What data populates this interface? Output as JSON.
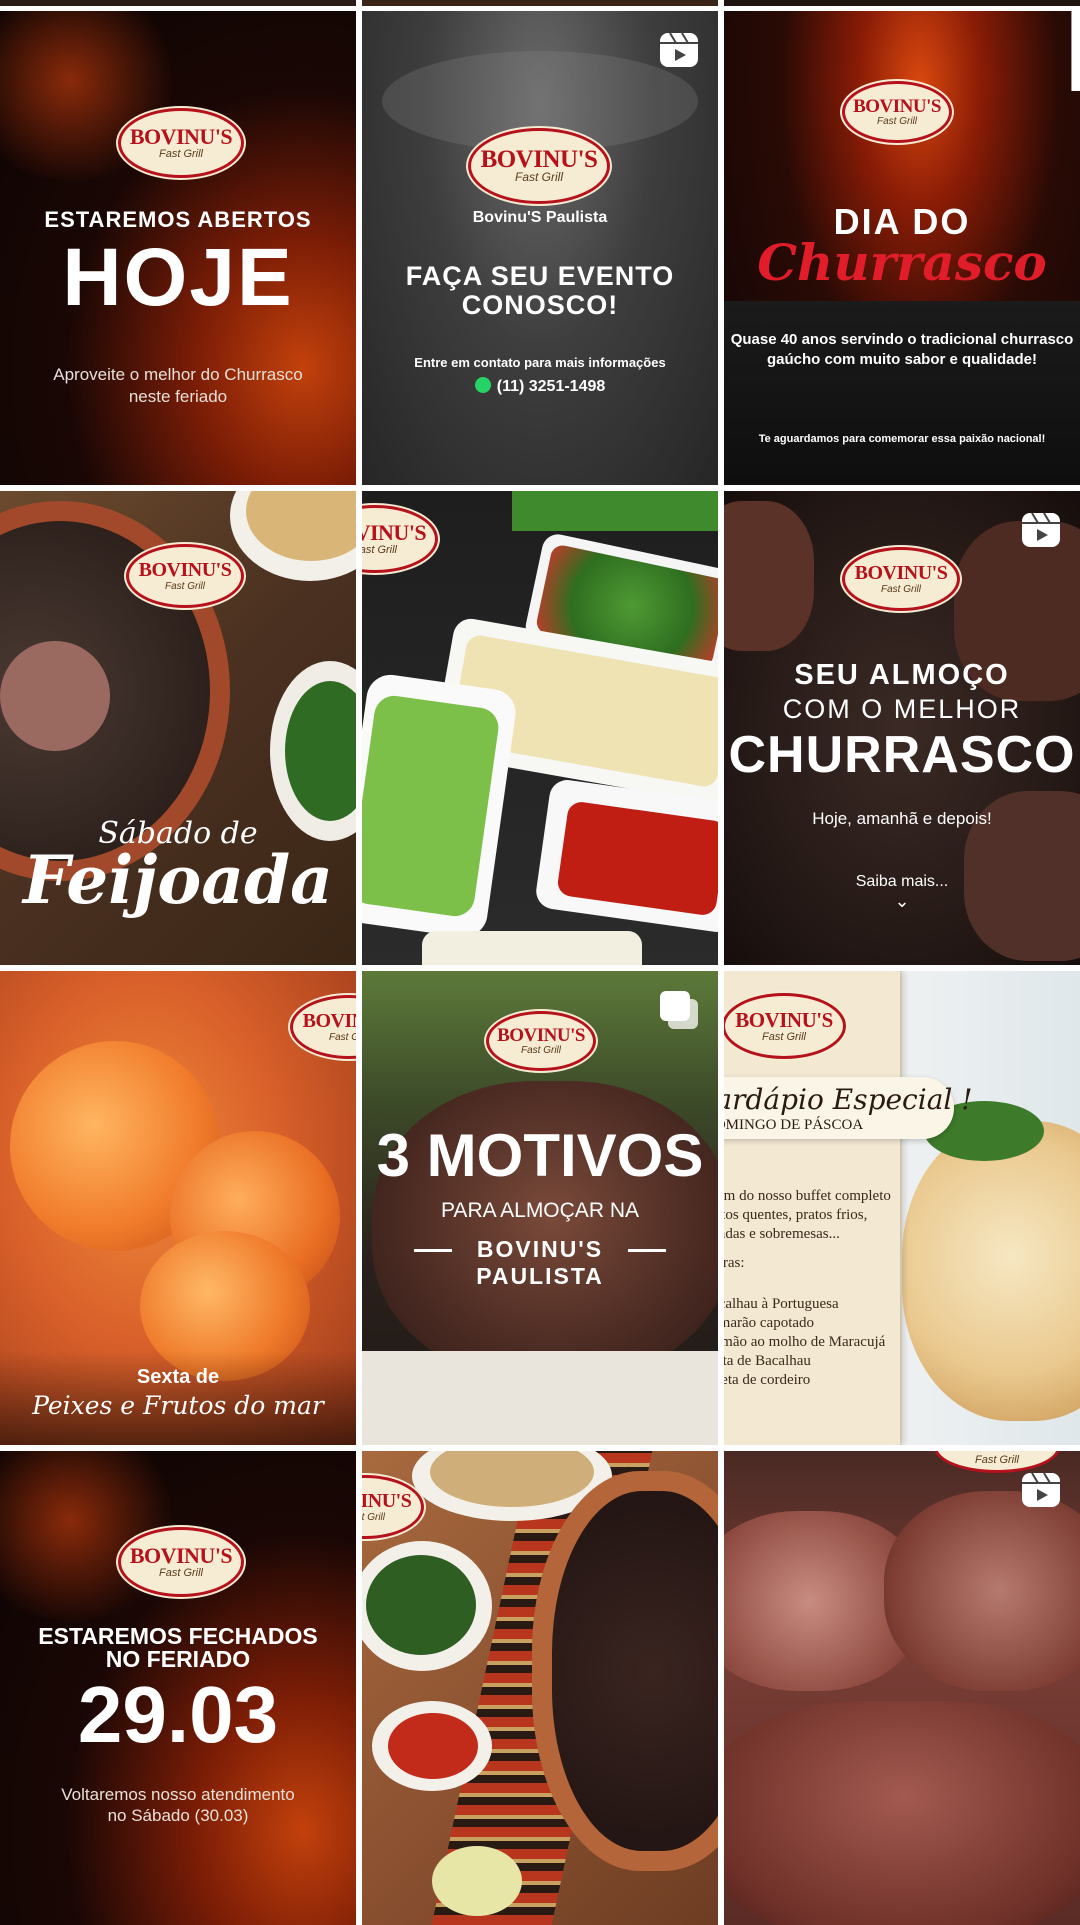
{
  "posts": [
    {
      "logo": {
        "name": "BOVINU'S",
        "sub": "Fast Grill"
      },
      "line1": "ESTAREMOS ABERTOS",
      "headline": "HOJE",
      "footer1": "Aproveite o melhor do Churrasco",
      "footer2": "neste feriado"
    },
    {
      "logo": {
        "name": "BOVINU'S",
        "sub": "Fast Grill"
      },
      "place": "Bovinu'S Paulista",
      "head1": "FAÇA SEU EVENTO",
      "head2": "CONOSCO!",
      "contact": "Entre em contato para mais informações",
      "phone": "(11) 3251-1498",
      "badge": "reel-icon"
    },
    {
      "logo": {
        "name": "BOVINU'S",
        "sub": "Fast Grill"
      },
      "head1": "DIA DO",
      "script": "Churrasco",
      "body1": "Quase 40 anos servindo o tradicional churrasco",
      "body2": "gaúcho com muito sabor e qualidade!",
      "footer": "Te aguardamos para comemorar essa paixão nacional!"
    },
    {
      "logo": {
        "name": "BOVINU'S",
        "sub": "Fast Grill"
      },
      "script1": "Sábado de",
      "script2": "Feijoada"
    },
    {
      "logo": {
        "name": "BOVINU'S",
        "sub": "Fast Grill"
      }
    },
    {
      "logo": {
        "name": "BOVINU'S",
        "sub": "Fast Grill"
      },
      "line1": "SEU ALMOÇO",
      "line2": "COM O MELHOR",
      "headline": "CHURRASCO",
      "sub": "Hoje, amanhã e depois!",
      "more": "Saiba mais...",
      "badge": "reel-icon"
    },
    {
      "logo": {
        "name": "BOVINU'S",
        "sub": "Fast Grill"
      },
      "line1": "Sexta de",
      "script": "Peixes e Frutos do mar"
    },
    {
      "logo": {
        "name": "BOVINU'S",
        "sub": "Fast Grill"
      },
      "headline": "3 MOTIVOS",
      "line1": "PARA ALMOÇAR NA",
      "line2": "BOVINU'S",
      "line3": "PAULISTA",
      "badge": "carousel-icon"
    },
    {
      "logo": {
        "name": "BOVINU'S",
        "sub": "Fast Grill"
      },
      "title": "Cardápio Especial !",
      "subtitle": "DOMINGO DE PÁSCOA",
      "intro": [
        "Além do nosso buffet completo",
        "pratos quentes, pratos frios,",
        "saladas e sobremesas..."
      ],
      "label": "Extras:",
      "items": [
        "Bacalhau à Portuguesa",
        "Camarão capotado",
        "Salmão ao molho de Maracujá",
        "Torta de Bacalhau",
        "Paleta de cordeiro"
      ]
    },
    {
      "logo": {
        "name": "BOVINU'S",
        "sub": "Fast Grill"
      },
      "line1": "ESTAREMOS FECHADOS",
      "line2": "NO FERIADO",
      "headline": "29.03",
      "footer1": "Voltaremos nosso atendimento",
      "footer2": "no Sábado (30.03)"
    },
    {
      "logo": {
        "name": "BOVINU'S",
        "sub": "Fast Grill"
      }
    },
    {
      "logo": {
        "name": "BOVINU'S",
        "sub": "Fast Grill"
      },
      "badge": "reel-icon"
    }
  ]
}
